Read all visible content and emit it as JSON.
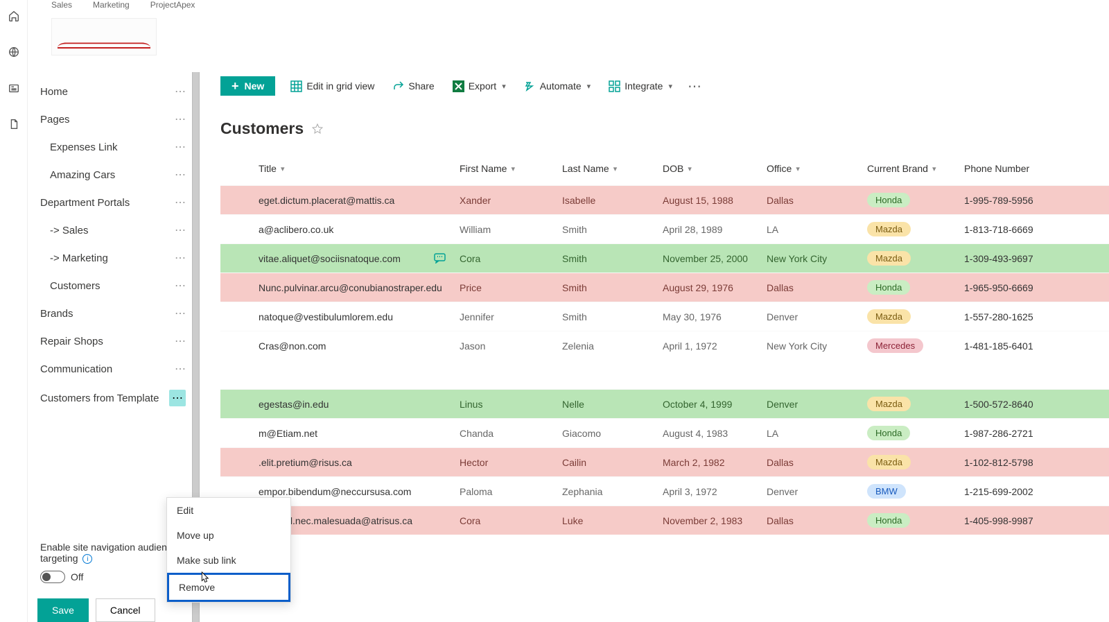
{
  "hub": {
    "a": "Sales",
    "b": "Marketing",
    "c": "ProjectApex"
  },
  "nav": {
    "home": "Home",
    "pages": "Pages",
    "expenses": "Expenses Link",
    "amazing": "Amazing Cars",
    "dept": "Department Portals",
    "sales": "-> Sales",
    "marketing": "-> Marketing",
    "customers": "Customers",
    "brands": "Brands",
    "repair": "Repair Shops",
    "comm": "Communication",
    "cft": "Customers from Template"
  },
  "audience": {
    "label": "Enable site navigation audience targeting",
    "state": "Off"
  },
  "btn": {
    "save": "Save",
    "cancel": "Cancel"
  },
  "ctx": {
    "edit": "Edit",
    "up": "Move up",
    "sub": "Make sub link",
    "rem": "Remove"
  },
  "cmd": {
    "new": "New",
    "grid": "Edit in grid view",
    "share": "Share",
    "export": "Export",
    "auto": "Automate",
    "integ": "Integrate"
  },
  "title": "Customers",
  "cols": {
    "title": "Title",
    "first": "First Name",
    "last": "Last Name",
    "dob": "DOB",
    "off": "Office",
    "brand": "Current Brand",
    "phone": "Phone Number"
  },
  "rows": [
    {
      "cls": "red",
      "title": "eget.dictum.placerat@mattis.ca",
      "first": "Xander",
      "last": "Isabelle",
      "dob": "August 15, 1988",
      "off": "Dallas",
      "brand": "Honda",
      "bcls": "honda",
      "phone": "1-995-789-5956",
      "cmt": false
    },
    {
      "cls": "",
      "title": "a@aclibero.co.uk",
      "first": "William",
      "last": "Smith",
      "dob": "April 28, 1989",
      "off": "LA",
      "brand": "Mazda",
      "bcls": "mazda",
      "phone": "1-813-718-6669",
      "cmt": false
    },
    {
      "cls": "green",
      "title": "vitae.aliquet@sociisnatoque.com",
      "first": "Cora",
      "last": "Smith",
      "dob": "November 25, 2000",
      "off": "New York City",
      "brand": "Mazda",
      "bcls": "mazda",
      "phone": "1-309-493-9697",
      "cmt": true
    },
    {
      "cls": "red",
      "title": "Nunc.pulvinar.arcu@conubianostraper.edu",
      "first": "Price",
      "last": "Smith",
      "dob": "August 29, 1976",
      "off": "Dallas",
      "brand": "Honda",
      "bcls": "honda",
      "phone": "1-965-950-6669",
      "cmt": false
    },
    {
      "cls": "",
      "title": "natoque@vestibulumlorem.edu",
      "first": "Jennifer",
      "last": "Smith",
      "dob": "May 30, 1976",
      "off": "Denver",
      "brand": "Mazda",
      "bcls": "mazda",
      "phone": "1-557-280-1625",
      "cmt": false
    },
    {
      "cls": "",
      "title": "Cras@non.com",
      "first": "Jason",
      "last": "Zelenia",
      "dob": "April 1, 1972",
      "off": "New York City",
      "brand": "Mercedes",
      "bcls": "merc",
      "phone": "1-481-185-6401",
      "cmt": false
    }
  ],
  "rows2": [
    {
      "cls": "green",
      "title": "egestas@in.edu",
      "first": "Linus",
      "last": "Nelle",
      "dob": "October 4, 1999",
      "off": "Denver",
      "brand": "Mazda",
      "bcls": "mazda",
      "phone": "1-500-572-8640"
    },
    {
      "cls": "",
      "title": "m@Etiam.net",
      "first": "Chanda",
      "last": "Giacomo",
      "dob": "August 4, 1983",
      "off": "LA",
      "brand": "Honda",
      "bcls": "honda",
      "phone": "1-987-286-2721"
    },
    {
      "cls": "red",
      "title": ".elit.pretium@risus.ca",
      "first": "Hector",
      "last": "Cailin",
      "dob": "March 2, 1982",
      "off": "Dallas",
      "brand": "Mazda",
      "bcls": "mazda",
      "phone": "1-102-812-5798"
    },
    {
      "cls": "",
      "title": "empor.bibendum@neccursusa.com",
      "first": "Paloma",
      "last": "Zephania",
      "dob": "April 3, 1972",
      "off": "Denver",
      "brand": "BMW",
      "bcls": "bmw",
      "phone": "1-215-699-2002"
    },
    {
      "cls": "red",
      "title": "eleifend.nec.malesuada@atrisus.ca",
      "first": "Cora",
      "last": "Luke",
      "dob": "November 2, 1983",
      "off": "Dallas",
      "brand": "Honda",
      "bcls": "honda",
      "phone": "1-405-998-9987"
    }
  ]
}
